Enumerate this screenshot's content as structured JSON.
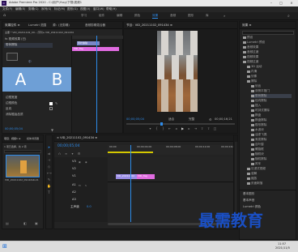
{
  "title_bar": {
    "text": "Adobe Premiere Pro 2020 - C:\\用户\\Ysxy\\下载\\视频1"
  },
  "menu": [
    "文件(F)",
    "编辑(E)",
    "剪辑(C)",
    "序列(S)",
    "标记(M)",
    "图形(G)",
    "视图(V)",
    "窗口(W)",
    "帮助(H)"
  ],
  "workspaces": [
    "学习",
    "组件",
    "编辑",
    "颜色",
    "效果",
    "音频",
    "图形",
    "库"
  ],
  "effect_controls": {
    "tabs": [
      "效果控件 ≡",
      "Lumetri 范围",
      "源：(无剪辑)",
      "音频剪辑混合器"
    ],
    "source_line": "主要 * VID_20211102_09...  序列 ▸ VID_20211102_091434",
    "fx_label": "fx  视频效果 (已)",
    "wipe_label": "带状擦除",
    "text_rows": [
      "边框宽度",
      "边框颜色",
      "反向",
      "消除锯齿品质"
    ],
    "anti_alias_value": "中",
    "a_label": "A",
    "b_label": "B",
    "timecode": "00;00;05;04"
  },
  "mini_timeline": {
    "clip_a": "带状擦除",
    "clip_b": "VID_Tag"
  },
  "program": {
    "tab": "节目：VID_20211102_091434 ≡",
    "timecode_left": "00;00;05;04",
    "fit": "适合",
    "full": "完整",
    "timecode_right": "00;00;16;21"
  },
  "effects_panel": {
    "tab": "效果 ≡",
    "items": [
      "预设",
      "Lumetri 预设",
      "音频效果",
      "音频过渡",
      "视频效果",
      "视频过渡",
      "3D 运动",
      "内滑",
      "划像",
      "擦除",
      "划出",
      "双侧平推门",
      "带状擦除",
      "径向擦除",
      "插入",
      "时钟式擦除",
      "棋盘",
      "棋盘擦除",
      "楔形擦除",
      "水波块",
      "油漆飞溅",
      "渐变擦除",
      "百叶窗",
      "螺旋框",
      "随机块",
      "随机擦除",
      "风车",
      "沉浸式视频",
      "溶解",
      "缩放",
      "页面剥落"
    ],
    "bottom_tabs": [
      "基本图形",
      "基本声音",
      "Lumetri 颜色"
    ]
  },
  "project": {
    "tabs": [
      "项目：视频1 ≡",
      "媒体浏览器"
    ],
    "items_count": "1 项已选择，共 2 项",
    "clip_name": "VID_20211102_09142...",
    "clip_duration": "16;21"
  },
  "timeline": {
    "tab": "× VID_20211102_091434 ≡",
    "timecode": "00;00;05;04",
    "ruler": [
      "00;00",
      "00;00;04;00",
      "00;00;08;00",
      "00;00;12;00",
      "00;00;16;00"
    ],
    "video_tracks": [
      "V3",
      "V2",
      "V1"
    ],
    "audio_tracks": [
      "A1",
      "A2",
      "A3"
    ],
    "master": "主声道",
    "master_value": "0.0",
    "clip_v1": "VID_20211102",
    "clip_v1b": "VID_Tag"
  },
  "watermark": "最需教育",
  "clock": {
    "time": "11:57",
    "date": "2021/11/5"
  },
  "colors": {
    "accent": "#2d8ceb",
    "transition_pink": "#e06be0",
    "clip_blue": "#7b86c6",
    "clip_purple": "#9b8de6",
    "fx_blue": "#6e9fd6",
    "watermark_blue": "#1a4fc4"
  }
}
